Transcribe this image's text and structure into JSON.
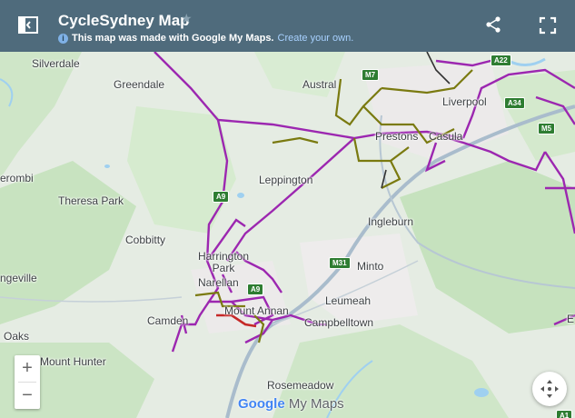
{
  "header": {
    "title": "CycleSydney Map",
    "subtitle_text": "This map was made with Google My Maps.",
    "subtitle_link": "Create your own.",
    "info_icon": "i"
  },
  "icons": {
    "legend_toggle": "sidebar-toggle-icon",
    "star": "star-icon",
    "share": "share-icon",
    "fullscreen": "fullscreen-icon",
    "locate": "recenter-icon"
  },
  "zoom": {
    "in": "+",
    "out": "−"
  },
  "branding": {
    "google": "Google",
    "mymaps": "My Maps"
  },
  "colors": {
    "header_bg": "#4f6b7c",
    "route_purple": "#9c27b0",
    "route_olive": "#7a7a10",
    "route_red": "#c62828",
    "water": "#9fd0f0",
    "park": "#cfe8c6"
  },
  "places": {
    "silverdale": "Silverdale",
    "greendale": "Greendale",
    "austral": "Austral",
    "liverpool": "Liverpool",
    "prestons": "Prestons",
    "casula": "Casula",
    "erombi": "erombi",
    "theresa_park": "Theresa Park",
    "leppington": "Leppington",
    "ingleburn": "Ingleburn",
    "cobbitty": "Cobbitty",
    "harrington_park": "Harrington Park",
    "narellan": "Narellan",
    "minto": "Minto",
    "ngeville": "ngeville",
    "leumeah": "Leumeah",
    "camden": "Camden",
    "mount_annan": "Mount Annan",
    "campbelltown": "Campbelltown",
    "oaks": "Oaks",
    "mount_hunter": "Mount Hunter",
    "rosemeadow": "Rosemeadow",
    "e": "E"
  },
  "shields": {
    "m7": "M7",
    "a22": "A22",
    "a34": "A34",
    "m5": "M5",
    "a9a": "A9",
    "a9b": "A9",
    "m31": "M31",
    "a1": "A1"
  }
}
